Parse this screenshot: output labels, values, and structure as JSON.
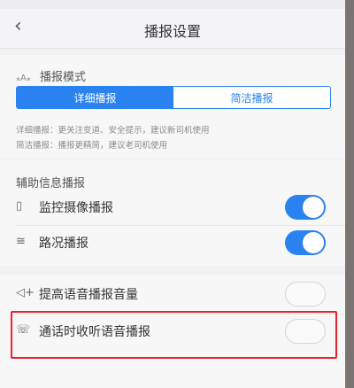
{
  "status_bar": {
    "carrier": "",
    "time": "",
    "battery": ""
  },
  "header": {
    "title": "播报设置",
    "back_icon": "chevron-left-icon"
  },
  "mode": {
    "title": "播报模式",
    "icon": "broadcast-icon",
    "options": [
      "详细播报",
      "简洁播报"
    ],
    "selected": "详细播报",
    "descriptions": [
      "详细播报：更关注变道、安全提示，建议新司机使用",
      "简洁播报：播报更精简，建议老司机使用"
    ]
  },
  "aux": {
    "title": "辅助信息播报",
    "items": [
      {
        "label": "监控摄像播报",
        "icon": "camera-icon",
        "enabled": true
      },
      {
        "label": "路况播报",
        "icon": "road-icon",
        "enabled": true
      }
    ]
  },
  "volume": {
    "items": [
      {
        "label": "提高语音播报音量",
        "icon": "speaker-plus-icon",
        "enabled": false
      },
      {
        "label": "通话时收听语音播报",
        "icon": "phone-icon",
        "enabled": false
      }
    ]
  },
  "colors": {
    "accent": "#2a82f0",
    "highlight": "#e8232a"
  }
}
